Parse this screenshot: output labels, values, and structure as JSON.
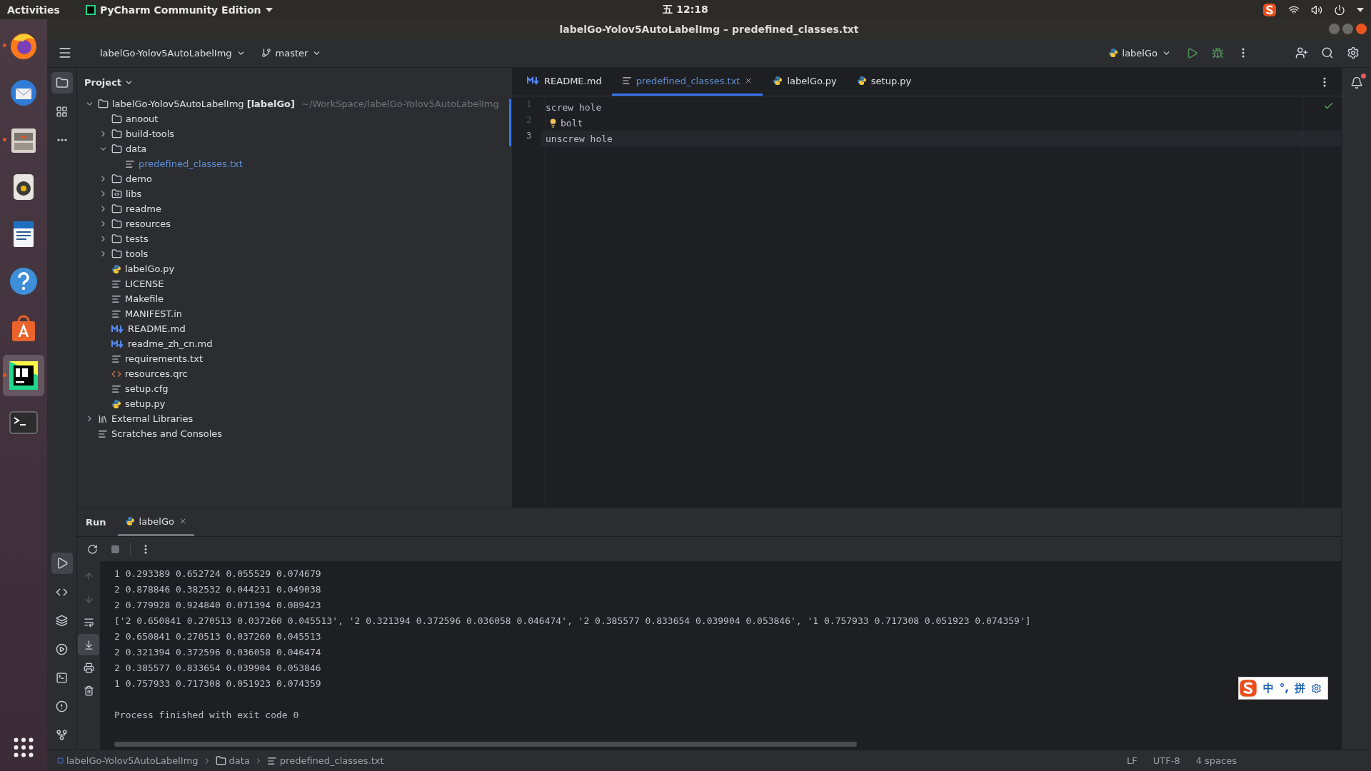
{
  "top_bar": {
    "activities": "Activities",
    "app": "PyCharm Community Edition",
    "clock": "五 12:18"
  },
  "dock": [
    {
      "kind": "firefox",
      "running": true,
      "selected": false
    },
    {
      "kind": "mail",
      "running": false,
      "selected": false
    },
    {
      "kind": "files",
      "running": true,
      "selected": false
    },
    {
      "kind": "music",
      "running": false,
      "selected": false
    },
    {
      "kind": "writer",
      "running": false,
      "selected": false
    },
    {
      "kind": "help",
      "running": false,
      "selected": false
    },
    {
      "kind": "store",
      "running": false,
      "selected": false
    },
    {
      "kind": "pycharm",
      "running": true,
      "selected": true
    },
    {
      "kind": "terminal",
      "running": false,
      "selected": false
    }
  ],
  "window": {
    "title": "labelGo-Yolov5AutoLabelImg – predefined_classes.txt"
  },
  "toolbar": {
    "project": "labelGo-Yolov5AutoLabelImg",
    "branch": "master",
    "run_config": "labelGo"
  },
  "project_panel": {
    "title": "Project",
    "tree": [
      {
        "name": "labelGo-Yolov5AutoLabelImg",
        "module": "[labelGo]",
        "path": "~/WorkSpace/labelGo-Yolov5AutoLabelImg",
        "kind": "folder",
        "expanded": true,
        "selected": false,
        "children": [
          {
            "name": "anoout",
            "kind": "empty_folder",
            "selected": false
          },
          {
            "name": "build-tools",
            "kind": "folder",
            "expanded": false,
            "selected": false
          },
          {
            "name": "data",
            "kind": "folder",
            "expanded": true,
            "selected": false,
            "children": [
              {
                "name": "predefined_classes.txt",
                "kind": "text",
                "selected": true
              }
            ]
          },
          {
            "name": "demo",
            "kind": "folder",
            "expanded": false,
            "selected": false
          },
          {
            "name": "libs",
            "kind": "source_folder",
            "expanded": false,
            "selected": false
          },
          {
            "name": "readme",
            "kind": "folder",
            "expanded": false,
            "selected": false
          },
          {
            "name": "resources",
            "kind": "folder",
            "expanded": false,
            "selected": false
          },
          {
            "name": "tests",
            "kind": "folder",
            "expanded": false,
            "selected": false
          },
          {
            "name": "tools",
            "kind": "folder",
            "expanded": false,
            "selected": false
          },
          {
            "name": "labelGo.py",
            "kind": "python",
            "selected": false
          },
          {
            "name": "LICENSE",
            "kind": "text",
            "selected": false
          },
          {
            "name": "Makefile",
            "kind": "text",
            "selected": false
          },
          {
            "name": "MANIFEST.in",
            "kind": "text",
            "selected": false
          },
          {
            "name": "README.md",
            "kind": "markdown",
            "selected": false
          },
          {
            "name": "readme_zh_cn.md",
            "kind": "markdown",
            "selected": false
          },
          {
            "name": "requirements.txt",
            "kind": "text",
            "selected": false
          },
          {
            "name": "resources.qrc",
            "kind": "xml",
            "selected": false
          },
          {
            "name": "setup.cfg",
            "kind": "text",
            "selected": false
          },
          {
            "name": "setup.py",
            "kind": "python",
            "selected": false
          }
        ]
      },
      {
        "name": "External Libraries",
        "kind": "library",
        "expanded": false,
        "selected": false
      },
      {
        "name": "Scratches and Consoles",
        "kind": "scratches",
        "selected": false
      }
    ]
  },
  "editor": {
    "tabs": [
      {
        "label": "README.md",
        "kind": "markdown",
        "selected": false
      },
      {
        "label": "predefined_classes.txt",
        "kind": "text",
        "selected": true
      },
      {
        "label": "labelGo.py",
        "kind": "python",
        "selected": false
      },
      {
        "label": "setup.py",
        "kind": "python",
        "selected": false
      }
    ],
    "lines": [
      {
        "number": "1",
        "text": "screw hole",
        "current": false,
        "hint": false
      },
      {
        "number": "2",
        "text": "bolt",
        "current": false,
        "hint": true
      },
      {
        "number": "3",
        "text": "unscrew hole",
        "current": true,
        "hint": false
      }
    ]
  },
  "run_panel": {
    "title": "Run",
    "tabs": [
      {
        "label": "labelGo",
        "selected": true
      }
    ],
    "output": [
      "1 0.293389 0.652724 0.055529 0.074679",
      "2 0.878846 0.382532 0.044231 0.049038",
      "2 0.779928 0.924840 0.071394 0.089423",
      "['2 0.650841 0.270513 0.037260 0.045513', '2 0.321394 0.372596 0.036058 0.046474', '2 0.385577 0.833654 0.039904 0.053846', '1 0.757933 0.717308 0.051923 0.074359']",
      "2 0.650841 0.270513 0.037260 0.045513",
      "2 0.321394 0.372596 0.036058 0.046474",
      "2 0.385577 0.833654 0.039904 0.053846",
      "1 0.757933 0.717308 0.051923 0.074359"
    ],
    "exit_message": "Process finished with exit code 0"
  },
  "status_bar": {
    "breadcrumbs": [
      {
        "label": "labelGo-Yolov5AutoLabelImg",
        "kind": "module"
      },
      {
        "label": "data",
        "kind": "folder"
      },
      {
        "label": "predefined_classes.txt",
        "kind": "text"
      }
    ],
    "items": [
      "LF",
      "UTF-8",
      "4 spaces"
    ]
  },
  "ime_bar": {
    "items": [
      "中",
      "°,",
      "拼"
    ]
  }
}
